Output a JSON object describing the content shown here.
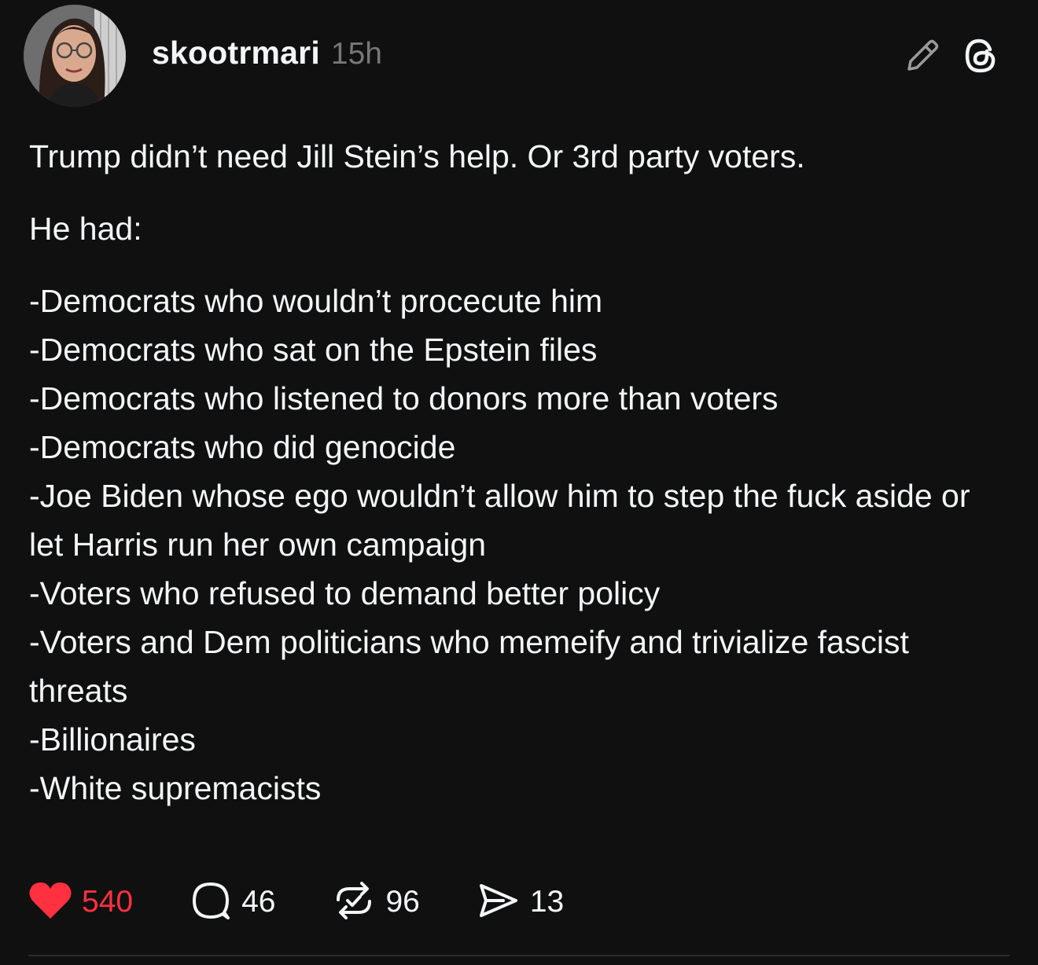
{
  "post": {
    "username": "skootrmari",
    "time": "15h",
    "avatar_alt": "profile-photo",
    "intro": "Trump didn’t need Jill Stein’s help. Or 3rd party voters.",
    "lead": "He had:",
    "list": [
      "-Democrats who wouldn’t procecute him",
      "-Democrats who sat on the Epstein files",
      "-Democrats who listened to donors more than voters",
      "-Democrats who did genocide",
      "-Joe Biden whose ego wouldn’t allow him to step the fuck aside or let Harris run her own campaign",
      "-Voters who refused to demand better policy",
      "-Voters and Dem politicians who memeify and trivialize fascist threats",
      "-Billionaires",
      "-White supremacists"
    ]
  },
  "actions": {
    "likes": "540",
    "replies": "46",
    "reposts": "96",
    "shares": "13"
  },
  "icons": {
    "edit": "pencil-icon",
    "app": "threads-logo-icon",
    "like": "heart-icon",
    "reply": "comment-icon",
    "repost": "repost-icon",
    "share": "send-icon"
  },
  "colors": {
    "background": "#101010",
    "text": "#f3f5f7",
    "secondary": "#777777",
    "like": "#ff3040"
  }
}
